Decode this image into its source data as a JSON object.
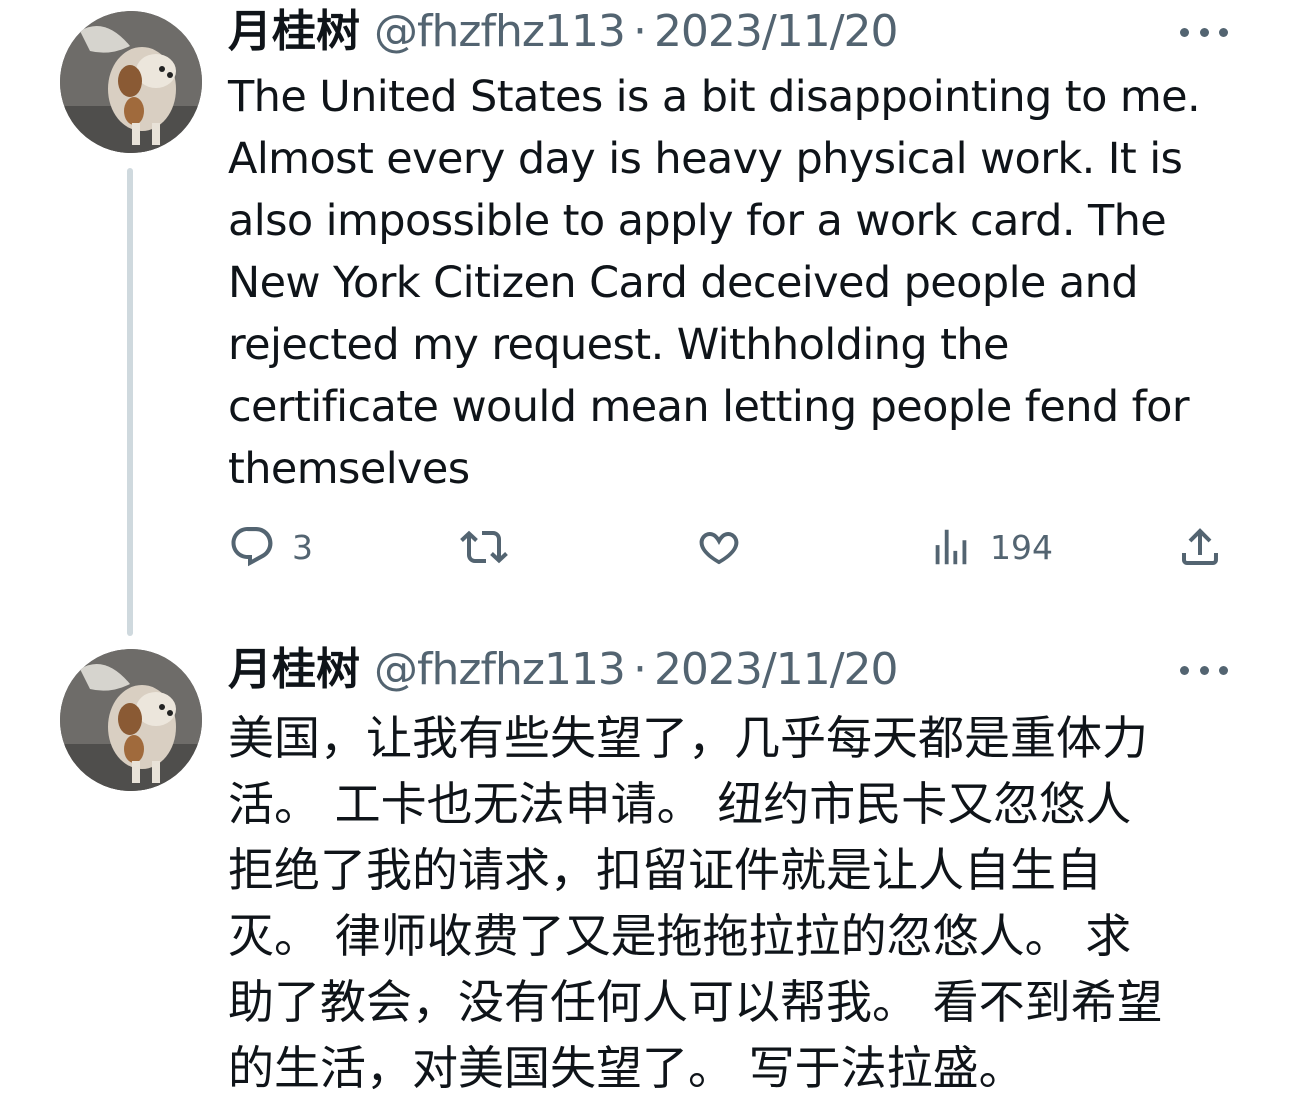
{
  "tweets": [
    {
      "display_name": "月桂树",
      "handle": "@fhzfhz113",
      "separator": "·",
      "date": "2023/11/20",
      "text": "The United States is a bit disappointing to me.\nAlmost every day is heavy physical work.  It is\nalso impossible to apply for a work card.  The\nNew York Citizen Card deceived people and\nrejected my request. Withholding the\ncertificate would mean letting people fend for\nthemselves",
      "actions": {
        "reply_icon": "reply-icon",
        "reply_count": "3",
        "retweet_icon": "retweet-icon",
        "like_icon": "heart-icon",
        "views_icon": "views-icon",
        "views_count": "194",
        "share_icon": "share-icon"
      }
    },
    {
      "display_name": "月桂树",
      "handle": "@fhzfhz113",
      "separator": "·",
      "date": "2023/11/20",
      "text": "美国，让我有些失望了，几乎每天都是重体力\n活。 工卡也无法申请。 纽约市民卡又忽悠人\n拒绝了我的请求，扣留证件就是让人自生自\n灭。 律师收费了又是拖拖拉拉的忽悠人。 求\n助了教会，没有任何人可以帮我。 看不到希望\n的生活，对美国失望了。 写于法拉盛。"
    }
  ],
  "colors": {
    "text_primary": "#0f1419",
    "text_secondary": "#536471",
    "thread_line": "#cfd9de"
  }
}
